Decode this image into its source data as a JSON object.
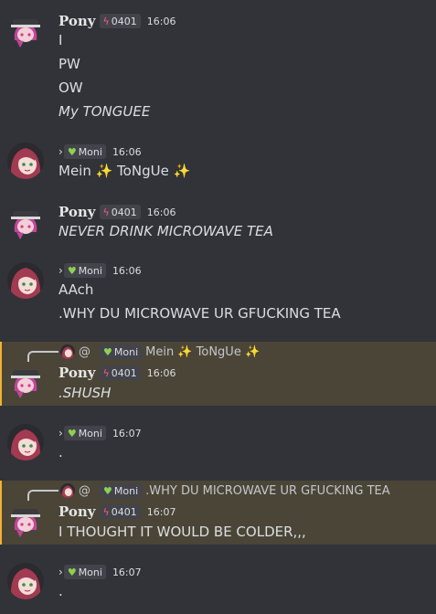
{
  "icons": {
    "pony_tag": "lightning-bolt-icon",
    "moni_tag": "green-heart-icon",
    "sparkle": "sparkles-icon",
    "reply_spine": "reply-arrow-icon"
  },
  "colors": {
    "mention_highlight": "#4a4537",
    "mention_bar": "#f0b232",
    "bolt": "#ff5a6b",
    "heart": "#8fd14f"
  },
  "messages": [
    {
      "user": "Pony",
      "tag": "0401",
      "time": "16:06",
      "lines": [
        "I",
        "PW",
        "OW",
        "My TONGUEE"
      ]
    },
    {
      "user": "Moni",
      "tag": "Moni",
      "time": "16:06",
      "lines": [
        "Mein ✨ ToNgUe ✨"
      ]
    },
    {
      "user": "Pony",
      "tag": "0401",
      "time": "16:06",
      "lines": [
        "NEVER DRINK MICROWAVE TEA"
      ]
    },
    {
      "user": "Moni",
      "tag": "Moni",
      "time": "16:06",
      "lines": [
        "AAch",
        ".WHY DU MICROWAVE UR GFUCKING TEA"
      ]
    },
    {
      "reply_to": {
        "at": "@",
        "tag": "Moni",
        "text": "Mein ✨ ToNgUe ✨"
      },
      "user": "Pony",
      "tag": "0401",
      "time": "16:06",
      "lines": [
        ".SHUSH"
      ]
    },
    {
      "user": "Moni",
      "tag": "Moni",
      "time": "16:07",
      "lines": [
        "."
      ]
    },
    {
      "reply_to": {
        "at": "@",
        "tag": "Moni",
        "text": ".WHY DU MICROWAVE UR GFUCKING TEA"
      },
      "user": "Pony",
      "tag": "0401",
      "time": "16:07",
      "lines": [
        "I THOUGHT IT WOULD BE COLDER,,,"
      ]
    },
    {
      "user": "Moni",
      "tag": "Moni",
      "time": "16:07",
      "lines": [
        "."
      ]
    }
  ]
}
